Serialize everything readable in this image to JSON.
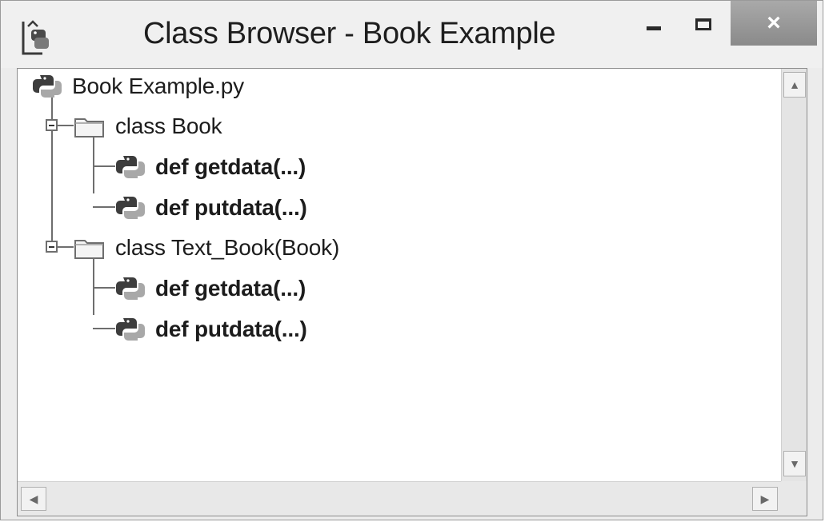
{
  "window": {
    "title": "Class Browser - Book Example",
    "close_glyph": "×",
    "app_icon": "idle-python-icon",
    "controls": [
      "minimize",
      "maximize",
      "close"
    ]
  },
  "tree": {
    "root": {
      "label": "Book Example.py",
      "icon": "python-file-icon"
    },
    "classes": [
      {
        "label": "class Book",
        "icon": "folder-icon",
        "expanded": true,
        "methods": [
          {
            "label": "def getdata(...)",
            "icon": "python-icon"
          },
          {
            "label": "def putdata(...)",
            "icon": "python-icon"
          }
        ]
      },
      {
        "label": "class Text_Book(Book)",
        "icon": "folder-icon",
        "expanded": true,
        "methods": [
          {
            "label": "def getdata(...)",
            "icon": "python-icon"
          },
          {
            "label": "def putdata(...)",
            "icon": "python-icon"
          }
        ]
      }
    ]
  },
  "scrollbars": {
    "up_glyph": "▲",
    "down_glyph": "▼",
    "left_glyph": "◀",
    "right_glyph": "▶"
  },
  "colors": {
    "close_button": "#9a9a9a",
    "tree_lines": "#6e6e6e",
    "background": "#ffffff"
  }
}
